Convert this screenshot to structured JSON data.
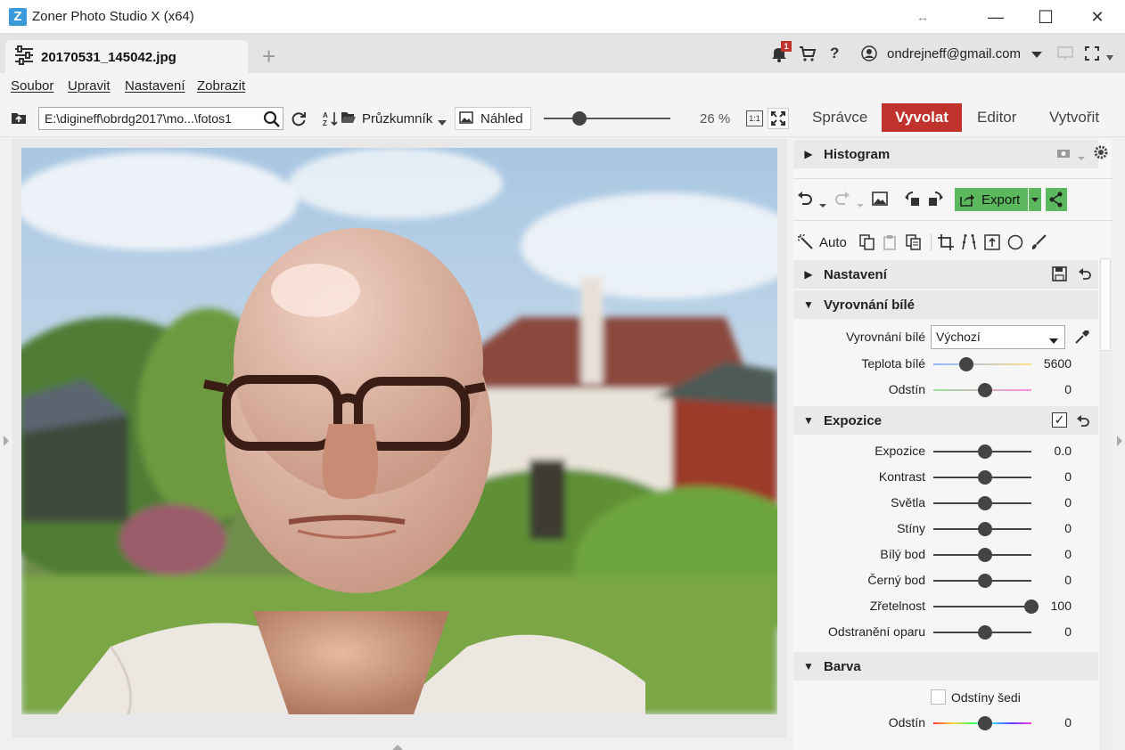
{
  "window": {
    "app_icon_glyph": "Z",
    "title": "Zoner Photo Studio X (x64)",
    "restore_glyph": "↔",
    "minimize_glyph": "—",
    "maximize_glyph": "☐",
    "close_glyph": "✕"
  },
  "tabs": {
    "active_file": "20170531_145042.jpg",
    "add_glyph": "+"
  },
  "account": {
    "notification_count": "1",
    "help_glyph": "?",
    "email": "ondrejneff@gmail.com"
  },
  "menu": {
    "items": [
      "Soubor",
      "Upravit",
      "Nastavení",
      "Zobrazit"
    ]
  },
  "toolbar": {
    "path_value": "E:\\digineff\\obrdg2017\\mo...\\fotos1",
    "browser_label": "Průzkumník",
    "preview_label": "Náhled",
    "zoom_percent": "26 %",
    "zoom_level_fraction": 0.28,
    "one_to_one_label": "1:1"
  },
  "modes": {
    "items": [
      "Správce",
      "Vyvolat",
      "Editor",
      "Vytvořit"
    ],
    "active": "Vyvolat",
    "active_color": "#c0322c"
  },
  "panel": {
    "histogram_title": "Histogram",
    "export_label": "Export",
    "export_color": "#5cb85c",
    "auto_label": "Auto",
    "sections": {
      "settings": "Nastavení",
      "white_balance": "Vyrovnání bílé",
      "exposure": "Expozice",
      "color": "Barva"
    },
    "white_balance": {
      "mode_label": "Vyrovnání bílé",
      "mode_value": "Výchozí",
      "rows": [
        {
          "label": "Teplota bílé",
          "value": "5600",
          "level": 0.3
        },
        {
          "label": "Odstín",
          "value": "0",
          "level": 0.5
        }
      ]
    },
    "exposure": {
      "enabled_mark": "✓",
      "rows": [
        {
          "label": "Expozice",
          "value": "0.0",
          "level": 0.5
        },
        {
          "label": "Kontrast",
          "value": "0",
          "level": 0.5
        },
        {
          "label": "Světla",
          "value": "0",
          "level": 0.5
        },
        {
          "label": "Stíny",
          "value": "0",
          "level": 0.5
        },
        {
          "label": "Bílý bod",
          "value": "0",
          "level": 0.5
        },
        {
          "label": "Černý bod",
          "value": "0",
          "level": 0.5
        },
        {
          "label": "Zřetelnost",
          "value": "100",
          "level": 1.0
        },
        {
          "label": "Odstranění oparu",
          "value": "0",
          "level": 0.5
        }
      ]
    },
    "color": {
      "grayscale_label": "Odstíny šedi",
      "rows": [
        {
          "label": "Odstín",
          "value": "0",
          "level": 0.5
        }
      ]
    }
  }
}
